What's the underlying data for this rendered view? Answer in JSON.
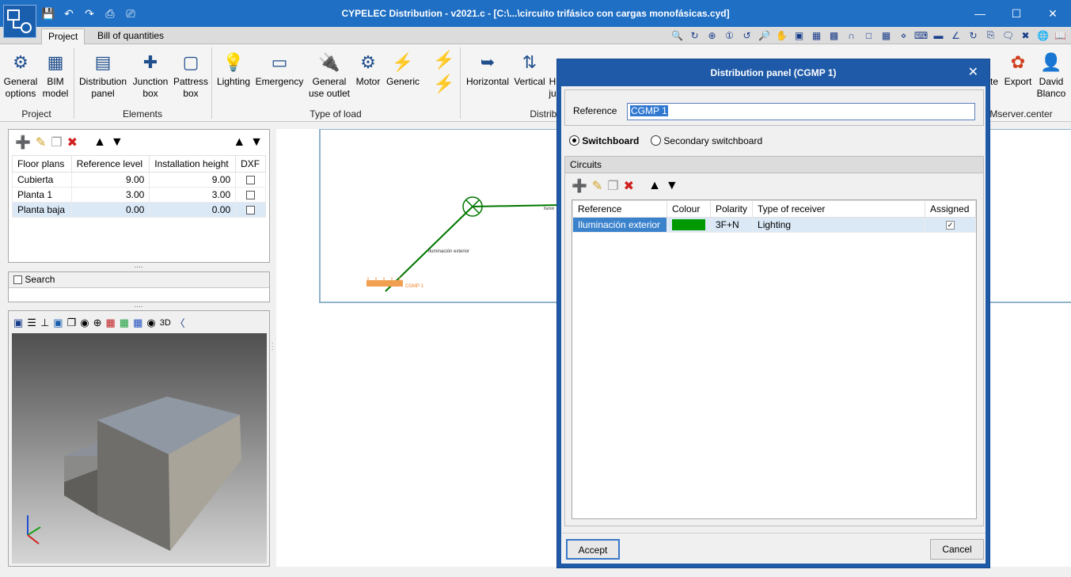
{
  "window": {
    "title": "CYPELEC Distribution - v2021.c - [C:\\...\\circuito trifásico con cargas monofásicas.cyd]",
    "minimize": "—",
    "maximize": "☐",
    "close": "✕"
  },
  "quick_access": [
    "save-icon",
    "undo-icon",
    "redo-icon",
    "print-icon",
    "print-preview-icon"
  ],
  "tabs": [
    {
      "label": "Project",
      "active": true
    },
    {
      "label": "Bill of quantities",
      "active": false
    }
  ],
  "ribbon": {
    "project": {
      "label": "Project",
      "buttons": [
        {
          "label_1": "General",
          "label_2": "options",
          "icon": "gear-icon"
        },
        {
          "label_1": "BIM",
          "label_2": "model",
          "icon": "grid-icon"
        }
      ]
    },
    "elements": {
      "label": "Elements",
      "buttons": [
        {
          "label_1": "Distribution",
          "label_2": "panel",
          "icon": "distribution-panel-icon"
        },
        {
          "label_1": "Junction",
          "label_2": "box",
          "icon": "junction-box-icon"
        },
        {
          "label_1": "Pattress",
          "label_2": "box",
          "icon": "pattress-box-icon"
        }
      ]
    },
    "type_of_load": {
      "label": "Type of load",
      "buttons": [
        {
          "label_1": "Lighting",
          "label_2": "",
          "icon": "lamp-icon"
        },
        {
          "label_1": "Emergency",
          "label_2": "",
          "icon": "emergency-light-icon"
        },
        {
          "label_1": "General",
          "label_2": "use outlet",
          "icon": "plug-icon"
        },
        {
          "label_1": "Motor",
          "label_2": "",
          "icon": "motor-icon"
        },
        {
          "label_1": "Generic",
          "label_2": "",
          "icon": "lightning-icon"
        }
      ]
    },
    "distribution": {
      "label": "Distribu",
      "buttons": [
        {
          "label_1": "Horizontal",
          "label_2": "",
          "icon": "horizontal-cable-icon"
        },
        {
          "label_1": "Vertical",
          "label_2": "",
          "icon": "vertical-cable-icon"
        },
        {
          "label_1": "H",
          "label_2": "ju",
          "icon": "junction-cable-icon"
        }
      ]
    },
    "right": {
      "label": "Mserver.center",
      "buttons": [
        {
          "label_1": "te",
          "label_2": "",
          "icon": "update-icon"
        },
        {
          "label_1": "Export",
          "label_2": "",
          "icon": "export-icon"
        },
        {
          "label_1": "David",
          "label_2": "Blanco",
          "icon": "user-avatar-icon"
        }
      ]
    }
  },
  "floor_plans": {
    "columns": [
      "Floor plans",
      "Reference level",
      "Installation height",
      "DXF"
    ],
    "rows": [
      {
        "name": "Cubierta",
        "ref_level": "9.00",
        "height": "9.00",
        "dxf": false
      },
      {
        "name": "Planta 1",
        "ref_level": "3.00",
        "height": "3.00",
        "dxf": false
      },
      {
        "name": "Planta baja",
        "ref_level": "0.00",
        "height": "0.00",
        "dxf": false,
        "selected": true
      }
    ]
  },
  "search": {
    "label": "Search"
  },
  "canvas": {
    "circuit_label": "Iluminación exterior",
    "panel_label": "CGMP 1",
    "top_label": "Ilumin"
  },
  "dialog": {
    "title": "Distribution panel (CGMP 1)",
    "close": "✕",
    "reference_label": "Reference",
    "reference_value": "CGMP 1",
    "switchboard_label": "Switchboard",
    "secondary_label": "Secondary switchboard",
    "circuits_label": "Circuits",
    "columns": [
      "Reference",
      "Colour",
      "Polarity",
      "Type of receiver",
      "Assigned"
    ],
    "rows": [
      {
        "reference": "Iluminación exterior",
        "colour": "#009900",
        "polarity": "3F+N",
        "type": "Lighting",
        "assigned": true
      }
    ],
    "accept": "Accept",
    "cancel": "Cancel"
  },
  "colors": {
    "titlebar": "#1f6fc4",
    "dialog_frame": "#1f5aa8",
    "selection": "#dbe9f7",
    "circuit": "#007700",
    "panel": "#f0a050"
  }
}
